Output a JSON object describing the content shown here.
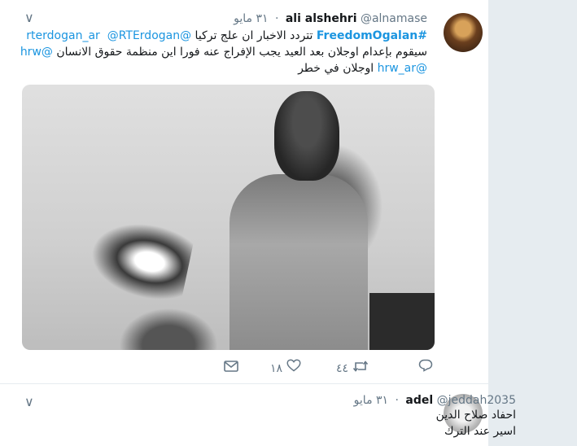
{
  "tweets": [
    {
      "name": "ali alshehri",
      "handle": "@alnamase",
      "time": "٣١ مايو",
      "line1": {
        "hashtag": "#FreedomOgalan",
        "text": " تتردد الاخبار ان علج تركيا ",
        "mention1": "@rterdogan_ar",
        "mention2": "@RTErdogan"
      },
      "line2": {
        "text": "سيقوم بإعدام اوجلان بعد العيد يجب الإفراج عنه فورا اين منظمة حقوق الانسان ",
        "mention": "@hrw"
      },
      "line3": {
        "mention": "@hrw_ar",
        "text": " اوجلان في خطر"
      },
      "actions": {
        "reply": "",
        "retweets": "٤٤",
        "likes": "١٨",
        "dm": ""
      }
    },
    {
      "name": "adel",
      "handle": "@jeddah2035",
      "time": "٣١ مايو",
      "lines": [
        "احفاد صلاح الدين",
        "اسير عند الترك"
      ]
    }
  ]
}
